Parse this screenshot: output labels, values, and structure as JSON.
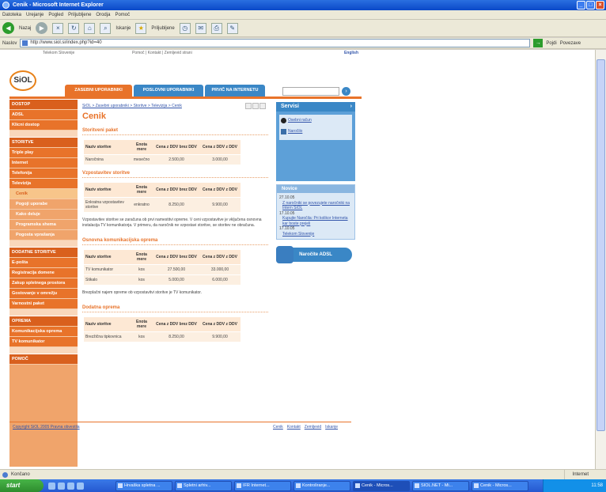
{
  "window": {
    "title": "Cenik - Microsoft Internet Explorer"
  },
  "menu": [
    "Datoteka",
    "Urejanje",
    "Pogled",
    "Priljubljene",
    "Orodja",
    "Pomoč"
  ],
  "toolbar": {
    "back": "Nazaj",
    "search": "Iskanje",
    "favorites": "Priljubljene"
  },
  "address": {
    "label": "Naslov",
    "url": "http://www.siol.si/index.php?id=40",
    "go": "Pojdi",
    "links": "Povezave"
  },
  "site": {
    "logo": "SiOL",
    "top_left": "Telekom Slovenije",
    "top_center": "Pomoč | Kontakt | Zemljevid strani",
    "top_right": "English",
    "tabs": [
      "ZASEBNI UPORABNIKI",
      "POSLOVNI UPORABNIKI",
      "PRVIČ NA INTERNETU"
    ]
  },
  "sidebar": [
    {
      "label": "DOSTOP",
      "kind": "head"
    },
    {
      "label": "ADSL",
      "kind": "item"
    },
    {
      "label": "Klicni dostop",
      "kind": "item"
    },
    {
      "label": "STORITVE",
      "kind": "head"
    },
    {
      "label": "Triple play",
      "kind": "item"
    },
    {
      "label": "Internet",
      "kind": "item"
    },
    {
      "label": "Telefonija",
      "kind": "item"
    },
    {
      "label": "Televizija",
      "kind": "item"
    },
    {
      "label": "Cenik",
      "kind": "active"
    },
    {
      "label": "Pogoji uporabe",
      "kind": "sub"
    },
    {
      "label": "Kako deluje",
      "kind": "sub"
    },
    {
      "label": "Programska shema",
      "kind": "sub"
    },
    {
      "label": "Pogosta vprašanja",
      "kind": "sub"
    },
    {
      "label": "DODATNE STORITVE",
      "kind": "head"
    },
    {
      "label": "E-pošta",
      "kind": "item"
    },
    {
      "label": "Registracija domene",
      "kind": "item"
    },
    {
      "label": "Zakup spletnega prostora",
      "kind": "item"
    },
    {
      "label": "Gostovanje v omrežju",
      "kind": "item"
    },
    {
      "label": "Varnostni paket",
      "kind": "item"
    },
    {
      "label": "OPREMA",
      "kind": "head"
    },
    {
      "label": "Komunikacijska oprema",
      "kind": "item"
    },
    {
      "label": "TV komunikator",
      "kind": "item"
    },
    {
      "label": "POMOČ",
      "kind": "head"
    }
  ],
  "content": {
    "breadcrumb": "SiOL > Zasebni uporabniki > Storitve > Televizija > Cenik",
    "title": "Cenik",
    "sec1": {
      "title": "Storitveni paket",
      "headers": [
        "Naziv storitve",
        "Enota mere",
        "Cena z DDV brez DDV",
        "Cena z DDV z DDV"
      ],
      "rows": [
        [
          "Naročnina",
          "mesečno",
          "2.500,00",
          "3.000,00"
        ]
      ]
    },
    "sec2": {
      "title": "Vzpostavitev storitve",
      "headers": [
        "Naziv storitve",
        "Enota mere",
        "Cena z DDV brez DDV",
        "Cena z DDV z DDV"
      ],
      "rows": [
        [
          "Enkratna vzpostavitev storitve",
          "enkratno",
          "8.250,00",
          "9.900,00"
        ]
      ],
      "note": "Vzpostavitev storitve se zaračuna ob prvi namestitvi opreme. V ceni vzpostavitve je vključena osnovna instalacija TV komunikatorja. V primeru, da naročnik ne vzpostavi storitve, se storitev ne obračuna."
    },
    "sec3": {
      "title": "Osnovna komunikacijska oprema",
      "headers": [
        "Naziv storitve",
        "Enota mere",
        "Cena z DDV brez DDV",
        "Cena z DDV z DDV"
      ],
      "rows": [
        [
          "TV komunikator",
          "kos",
          "27.500,00",
          "33.000,00"
        ],
        [
          "Stikalo",
          "kos",
          "5.000,00",
          "6.000,00"
        ]
      ],
      "note": "Brezplačni najem opreme ob vzpostavitvi storitve je TV komunikator."
    },
    "sec4": {
      "title": "Dodatna oprema",
      "headers": [
        "Naziv storitve",
        "Enota mere",
        "Cena z DDV brez DDV",
        "Cena z DDV z DDV"
      ],
      "rows": [
        [
          "Brezžična tipkovnica",
          "kos",
          "8.250,00",
          "9.900,00"
        ]
      ]
    }
  },
  "servisi": {
    "title": "Servisi",
    "links": [
      "Osebni račun",
      "Naročilo"
    ]
  },
  "novice": {
    "title": "Novice",
    "items": [
      {
        "date": "27.10.05",
        "text": "Z naročniki se povezujete naročniki na Intern SiOL"
      },
      {
        "date": "17.10.05",
        "text": "Kupujte Naročila: Pri kolikor Interneta kar boste prejeli"
      },
      {
        "date": "17.10.05",
        "text": "Telekom Slovenije"
      }
    ]
  },
  "narocite": "Naročite ADSL",
  "footer": {
    "left": "Copyright SiOL 2005 Pravna obvestila",
    "right": [
      "Cenik",
      "Kontakt",
      "Zemljevid",
      "Iskanje"
    ]
  },
  "status": {
    "left": "Končano",
    "zone": "Internet"
  },
  "taskbar": {
    "start": "start",
    "tasks": [
      "Hrvaška spletna ...",
      "Spletni arhiv...",
      "IFR Internet...",
      "Kontroliranje...",
      "Cenik - Micros...",
      "SIOL.NET - Mi...",
      "Cenik - Micros..."
    ],
    "clock": "11:58"
  },
  "colors": {
    "accent_orange": "#e8732a",
    "accent_blue": "#3a87c6"
  }
}
